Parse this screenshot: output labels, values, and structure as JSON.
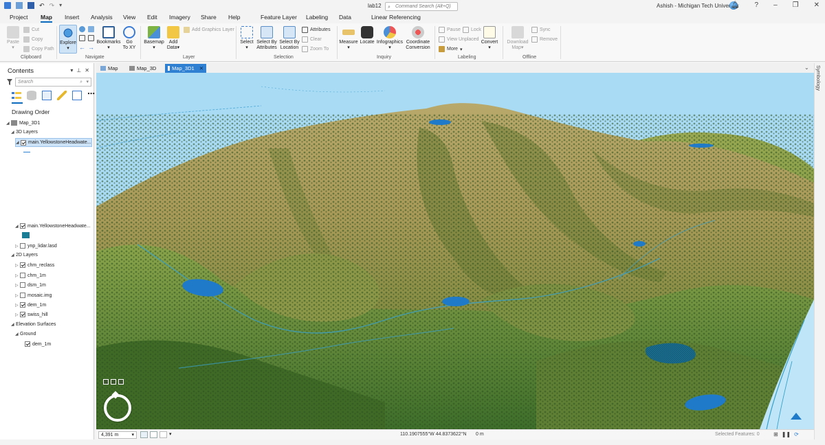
{
  "window": {
    "doc_title": "lab12",
    "command_search_placeholder": "Command Search (Alt+Q)",
    "user": "Ashish - Michigan Tech University",
    "help": "?",
    "minimize": "–",
    "restore": "❐",
    "close": "✕"
  },
  "menu_tabs": [
    "Project",
    "Map",
    "Insert",
    "Analysis",
    "View",
    "Edit",
    "Imagery",
    "Share",
    "Help",
    "Feature Layer",
    "Labeling",
    "Data",
    "Linear Referencing"
  ],
  "ribbon": {
    "clipboard": {
      "paste": "Paste",
      "cut": "Cut",
      "copy": "Copy",
      "copy_path": "Copy Path",
      "label": "Clipboard"
    },
    "navigate": {
      "explore": "Explore",
      "bookmarks": "Bookmarks",
      "go_to_xy_1": "Go",
      "go_to_xy_2": "To XY",
      "label": "Navigate"
    },
    "layer": {
      "basemap": "Basemap",
      "add_data_1": "Add",
      "add_data_2": "Data",
      "add_graphics_layer": "Add Graphics Layer",
      "label": "Layer"
    },
    "selection": {
      "select": "Select",
      "select_by_attr_1": "Select By",
      "select_by_attr_2": "Attributes",
      "select_by_loc_1": "Select By",
      "select_by_loc_2": "Location",
      "attributes": "Attributes",
      "clear": "Clear",
      "zoom_to": "Zoom To",
      "label": "Selection"
    },
    "inquiry": {
      "measure": "Measure",
      "locate": "Locate",
      "infographics": "Infographics",
      "coord_conv_1": "Coordinate",
      "coord_conv_2": "Conversion",
      "label": "Inquiry"
    },
    "labeling": {
      "pause": "Pause",
      "lock": "Lock",
      "view_unplaced": "View Unplaced",
      "more": "More",
      "convert": "Convert",
      "label": "Labeling"
    },
    "offline": {
      "download_map_1": "Download",
      "download_map_2": "Map",
      "sync": "Sync",
      "remove": "Remove",
      "label": "Offline"
    }
  },
  "contents": {
    "title": "Contents",
    "search_placeholder": "Search",
    "drawing_order": "Drawing Order",
    "map_name": "Map_3D1",
    "groups": {
      "layers_3d": "3D Layers",
      "layers_2d": "2D Layers",
      "elevation": "Elevation Surfaces",
      "ground": "Ground"
    },
    "layers_3d": [
      {
        "name": "main.YellowstoneHeadwate...",
        "checked": true
      },
      {
        "name": "main.YellowstoneHeadwate...",
        "checked": true
      },
      {
        "name": "ynp_lidar.lasd",
        "checked": false
      }
    ],
    "layers_2d": [
      {
        "name": "chm_reclass",
        "checked": true
      },
      {
        "name": "chm_1m",
        "checked": false
      },
      {
        "name": "dsm_1m",
        "checked": false
      },
      {
        "name": "mosaic.img",
        "checked": false
      },
      {
        "name": "dem_1m",
        "checked": true
      },
      {
        "name": "swiss_hill",
        "checked": true
      }
    ],
    "ground_layers": [
      {
        "name": "dem_1m",
        "checked": true
      }
    ]
  },
  "view_tabs": [
    "Map",
    "Map_3D",
    "Map_3D1"
  ],
  "side_pane_label": "Symbology",
  "status": {
    "scale": "4,391 m",
    "coordinates": "110.1907555°W 44.8373622°N",
    "elevation": "0 m",
    "selected_features": "Selected Features: 0"
  },
  "colors": {
    "accent": "#0b6cbf",
    "active_tab": "#2f7fd3",
    "sky": "#a9dcf4",
    "water": "#1f7bc9",
    "terrain_green": "#6e8f3a"
  }
}
